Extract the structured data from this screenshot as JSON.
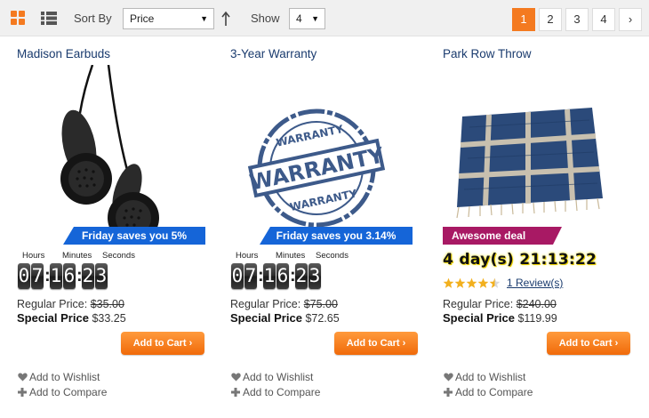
{
  "toolbar": {
    "view_grid_icon": "grid-view-icon",
    "view_list_icon": "list-view-icon",
    "sort_by_label": "Sort By",
    "sort_selected": "Price",
    "sort_direction_icon": "sort-ascending-arrow-icon",
    "show_label": "Show",
    "show_selected": "4",
    "pages": [
      "1",
      "2",
      "3",
      "4"
    ],
    "active_page": "1",
    "next_label": "›",
    "accent_color": "#f47a20"
  },
  "products": [
    {
      "name": "Madison Earbuds",
      "image_icon": "earbuds-image",
      "ribbon": "Friday saves you 5%",
      "countdown": {
        "labels": [
          "Hours",
          "Minutes",
          "Seconds"
        ],
        "hours": [
          "0",
          "7"
        ],
        "minutes": [
          "1",
          "6"
        ],
        "seconds": [
          "2",
          "3"
        ]
      },
      "regular_label": "Regular Price:",
      "regular_price": "$35.00",
      "special_label": "Special Price",
      "special_price": "$33.25",
      "cart_label": "Add to Cart ›",
      "wishlist_label": "Add to Wishlist",
      "compare_label": "Add to Compare"
    },
    {
      "name": "3-Year Warranty",
      "image_icon": "warranty-stamp-image",
      "ribbon": "Friday saves you 3.14%",
      "countdown": {
        "labels": [
          "Hours",
          "Minutes",
          "Seconds"
        ],
        "hours": [
          "0",
          "7"
        ],
        "minutes": [
          "1",
          "6"
        ],
        "seconds": [
          "2",
          "3"
        ]
      },
      "regular_label": "Regular Price:",
      "regular_price": "$75.00",
      "special_label": "Special Price",
      "special_price": "$72.65",
      "cart_label": "Add to Cart ›",
      "wishlist_label": "Add to Wishlist",
      "compare_label": "Add to Compare"
    },
    {
      "name": "Park Row Throw",
      "image_icon": "blanket-throw-image",
      "ribbon": "Awesome deal",
      "days_timer": "4 day(s) 21:13:22",
      "rating_stars": 4.5,
      "rating_max": 5,
      "review_link": "1 Review(s)",
      "regular_label": "Regular Price:",
      "regular_price": "$240.00",
      "special_label": "Special Price",
      "special_price": "$119.99",
      "cart_label": "Add to Cart ›",
      "wishlist_label": "Add to Wishlist",
      "compare_label": "Add to Compare"
    }
  ],
  "colors": {
    "ribbon_blue": "#1565d8",
    "ribbon_pink": "#a81964",
    "cart_orange": "#f47a20",
    "link_blue": "#1a3b6e",
    "star_gold": "#f2b01e"
  }
}
